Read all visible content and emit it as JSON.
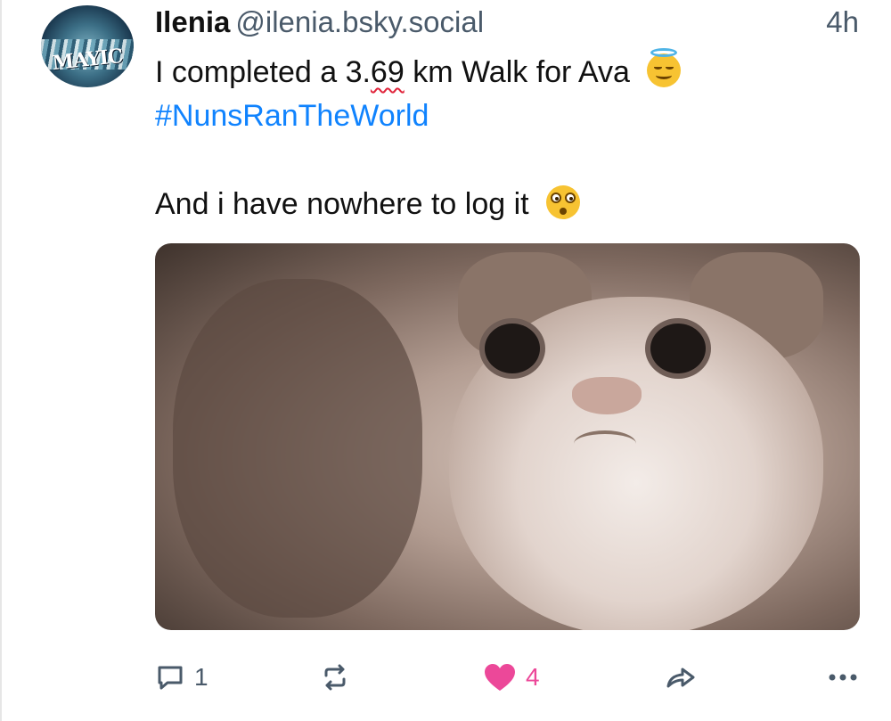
{
  "post": {
    "author": {
      "display_name": "Ilenia",
      "handle": "@ilenia.bsky.social",
      "avatar_text": "MAYIC"
    },
    "timestamp": "4h",
    "text": {
      "line1_prefix": "I completed a 3.",
      "line1_underlined": "69",
      "line1_suffix": " km Walk for Ava",
      "hashtag": "#NunsRanTheWorld",
      "line3": "And i have nowhere to log it"
    },
    "emojis": [
      "smiling-face-with-halo",
      "flushed-face"
    ],
    "media": {
      "description_icon": "cat-gif"
    },
    "actions": {
      "reply_count": "1",
      "repost_count": "",
      "like_count": "4",
      "like_color": "#ec4899"
    }
  },
  "colors": {
    "hashtag": "#1083fe",
    "muted": "#4a5a6a",
    "like": "#ec4899"
  }
}
